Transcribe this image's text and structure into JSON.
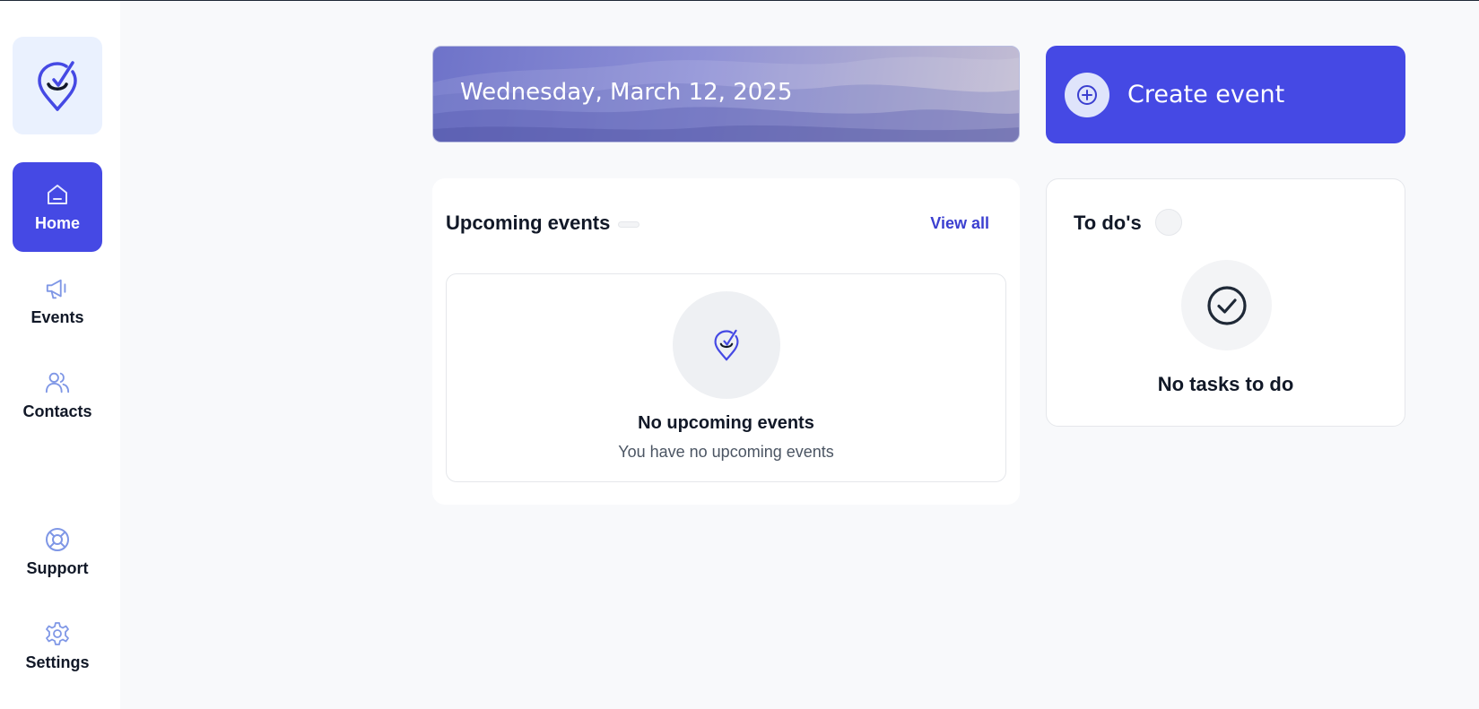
{
  "sidebar": {
    "logo_icon": "map-pin-check-logo-icon",
    "items": [
      {
        "label": "Home",
        "icon": "home-icon",
        "active": true
      },
      {
        "label": "Events",
        "icon": "megaphone-icon",
        "active": false
      },
      {
        "label": "Contacts",
        "icon": "users-icon",
        "active": false
      },
      {
        "label": "Support",
        "icon": "lifebuoy-icon",
        "active": false
      },
      {
        "label": "Settings",
        "icon": "gear-icon",
        "active": false
      }
    ]
  },
  "banner": {
    "date": "Wednesday, March 12, 2025"
  },
  "create_event": {
    "label": "Create event",
    "icon": "plus-circle-icon"
  },
  "upcoming_events": {
    "title": "Upcoming events",
    "count": "",
    "view_all_label": "View all",
    "empty_title": "No upcoming events",
    "empty_subtitle": "You have no upcoming events"
  },
  "todos": {
    "title": "To do's",
    "count": "",
    "empty_title": "No tasks to do"
  },
  "colors": {
    "accent": "#4549e4",
    "link": "#3b3fd0",
    "background": "#f8f9fb",
    "icon_muted": "#7f97e6"
  }
}
